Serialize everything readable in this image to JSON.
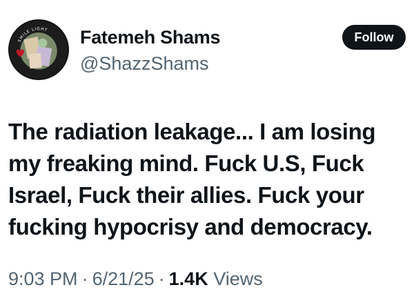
{
  "user": {
    "display_name": "Fatemeh Shams",
    "handle": "@ShazzShams"
  },
  "follow_label": "Follow",
  "tweet": {
    "text": "The radiation leakage... I am losing my freaking mind. Fuck U.S, Fuck Israel, Fuck their allies. Fuck your fucking hypocrisy and democracy."
  },
  "meta": {
    "time": "9:03 PM",
    "separator": "·",
    "date": "6/21/25",
    "views_count": "1.4K",
    "views_label": "Views"
  },
  "avatar": {
    "ring_text": "SMILE LIGHT"
  },
  "colors": {
    "text_primary": "#0f1419",
    "text_secondary": "#536471",
    "button_bg": "#0f1419",
    "button_text": "#ffffff"
  }
}
